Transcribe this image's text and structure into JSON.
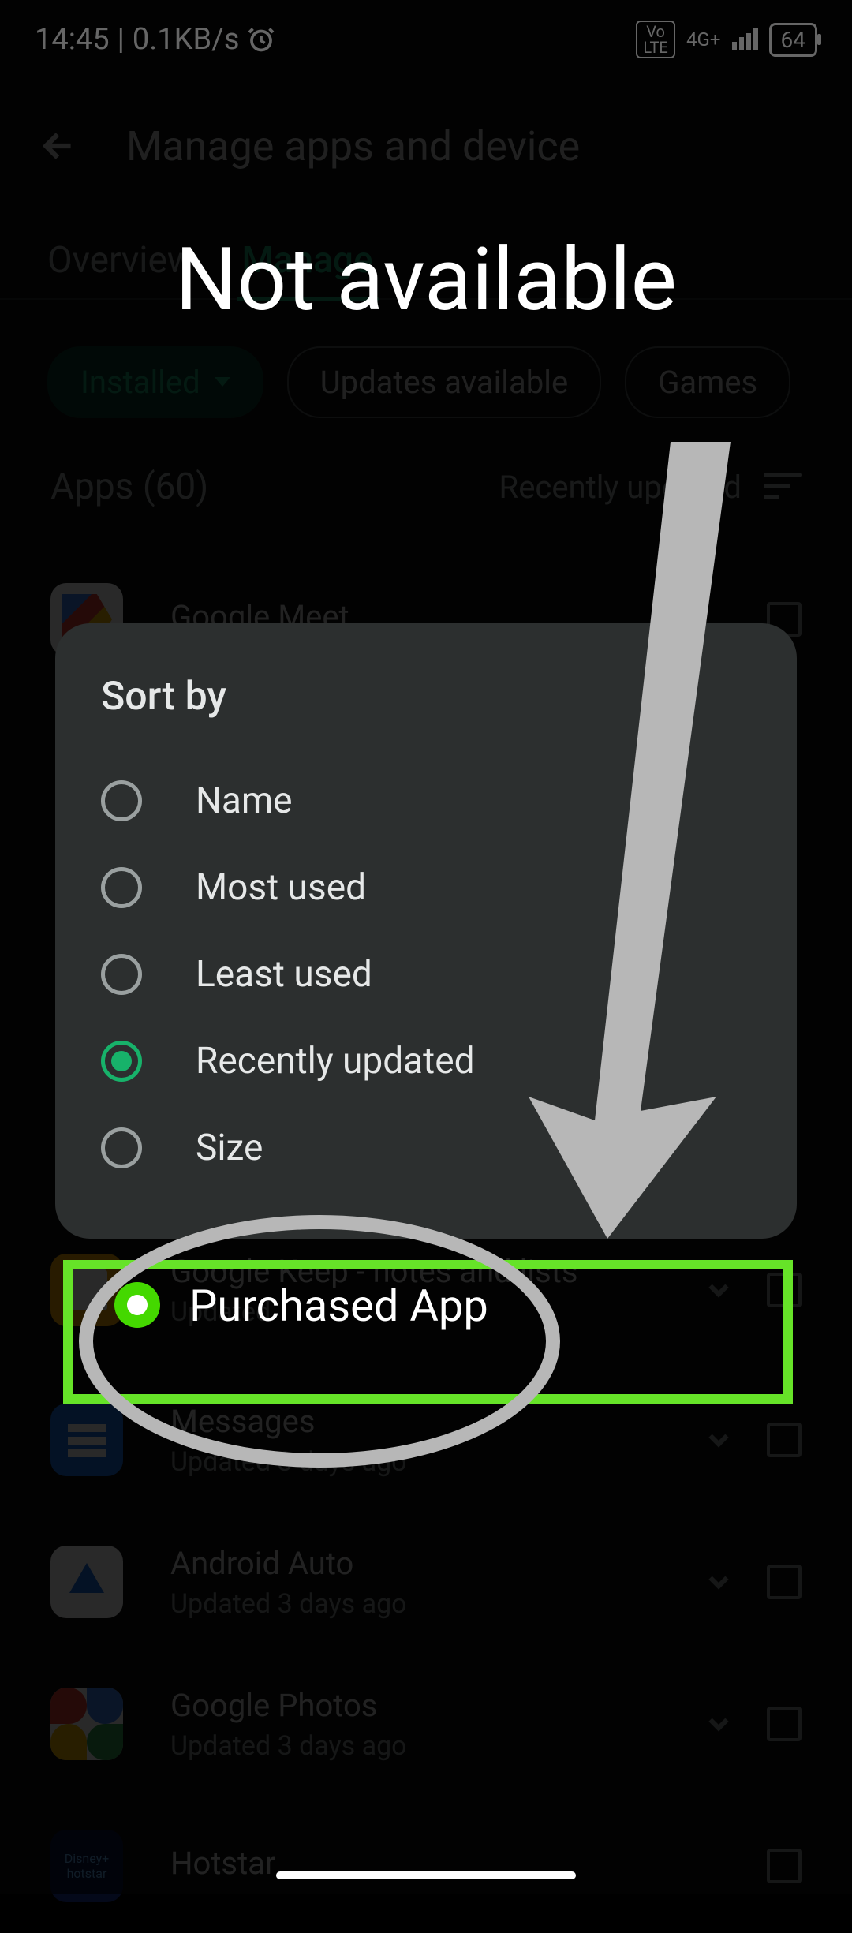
{
  "status": {
    "time": "14:45",
    "network_speed": "0.1KB/s",
    "volte_top": "Vo",
    "volte_bottom": "LTE",
    "signal_label": "4G+",
    "battery": "64"
  },
  "header": {
    "title": "Manage apps and device"
  },
  "tabs": {
    "overview": "Overview",
    "manage": "Manage"
  },
  "chips": {
    "installed": "Installed",
    "updates": "Updates available",
    "games": "Games"
  },
  "list_meta": {
    "apps_count": "Apps (60)",
    "sort_label": "Recently updated"
  },
  "apps": [
    {
      "name": "Google Meet",
      "sub": ""
    },
    {
      "name": "Google Keep - notes and lists",
      "sub": "Updated"
    },
    {
      "name": "Messages",
      "sub": "Updated 3 days ago"
    },
    {
      "name": "Android Auto",
      "sub": "Updated 3 days ago"
    },
    {
      "name": "Google Photos",
      "sub": "Updated 3 days ago"
    },
    {
      "name": "Hotstar",
      "sub": ""
    }
  ],
  "dialog": {
    "title": "Sort by",
    "options": [
      {
        "label": "Name",
        "selected": false
      },
      {
        "label": "Most used",
        "selected": false
      },
      {
        "label": "Least used",
        "selected": false
      },
      {
        "label": "Recently updated",
        "selected": true
      },
      {
        "label": "Size",
        "selected": false
      }
    ]
  },
  "annotation": {
    "headline": "Not available",
    "purchased_label": "Purchased App"
  }
}
